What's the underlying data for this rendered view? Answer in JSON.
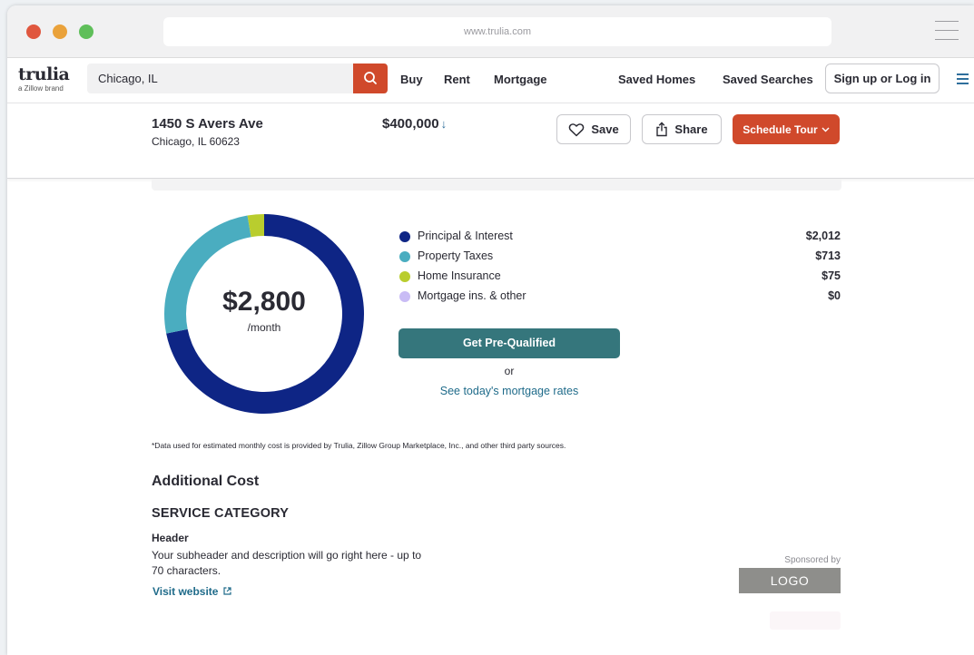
{
  "browser": {
    "url": "www.trulia.com"
  },
  "brand": {
    "name": "trulia",
    "tagline": "a Zillow brand"
  },
  "search": {
    "value": "Chicago, IL"
  },
  "nav": {
    "links": [
      "Buy",
      "Rent",
      "Mortgage",
      "Saved Homes",
      "Saved Searches"
    ],
    "login_label": "Sign up or Log in"
  },
  "listing": {
    "address": "1450 S Avers Ave",
    "city": "Chicago, IL 60623",
    "price": "$400,000",
    "save_label": "Save",
    "share_label": "Share",
    "tour_label": "Schedule Tour"
  },
  "payment": {
    "amount": "$2,800",
    "unit": "/month",
    "breakdown": [
      {
        "label": "Principal & Interest",
        "value": "$2,012",
        "amount": 2012,
        "color": "#0e2585"
      },
      {
        "label": "Property Taxes",
        "value": "$713",
        "amount": 713,
        "color": "#4aadc0"
      },
      {
        "label": "Home Insurance",
        "value": "$75",
        "amount": 75,
        "color": "#b9cd2e"
      },
      {
        "label": "Mortgage ins. & other",
        "value": "$0",
        "amount": 0,
        "color": "#c9bcf5"
      }
    ],
    "prequal_label": "Get Pre-Qualified",
    "or_text": "or",
    "rates_link": "See today's mortgage rates",
    "disclaimer": "*Data used for estimated monthly cost is provided by Trulia, Zillow Group Marketplace, Inc., and other third party sources."
  },
  "additional": {
    "title": "Additional Cost",
    "category": "SERVICE CATEGORY",
    "header": "Header",
    "description": "Your subheader and description will go right here - up to 70 characters.",
    "visit_label": "Visit website",
    "sponsored_label": "Sponsored by",
    "logo_label": "LOGO"
  },
  "colors": {
    "accent": "#d0492b",
    "teal_button": "#35767c",
    "link": "#1f6b8a"
  }
}
